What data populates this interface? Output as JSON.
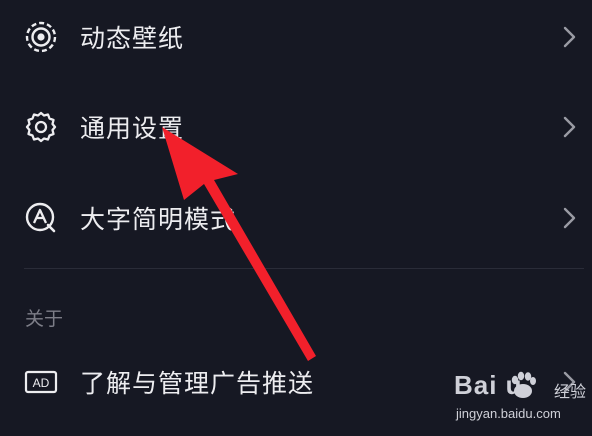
{
  "menu": {
    "items": [
      {
        "label": "动态壁纸",
        "icon": "live-wallpaper-icon"
      },
      {
        "label": "通用设置",
        "icon": "gear-icon"
      },
      {
        "label": "大字简明模式",
        "icon": "large-font-icon"
      }
    ]
  },
  "about": {
    "section_title": "关于",
    "items": [
      {
        "label": "了解与管理广告推送",
        "icon": "ad-icon",
        "icon_text": "AD"
      }
    ]
  },
  "annotation": {
    "color": "#f2202b"
  },
  "watermark": {
    "logo_text": "Bai  u",
    "brand": "经验",
    "url": "jingyan.baidu.com"
  },
  "colors": {
    "background": "#161823",
    "text": "#ededf0",
    "muted": "#7d7e88"
  }
}
